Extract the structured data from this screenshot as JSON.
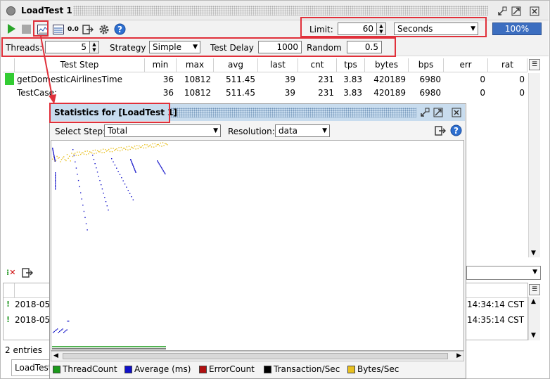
{
  "window": {
    "title": "LoadTest 1"
  },
  "toolbar": {
    "limit_label": "Limit:",
    "limit_value": "60",
    "limit_unit": "Seconds",
    "progress": "100%",
    "rate_display": "0.0"
  },
  "settings": {
    "threads_label": "Threads:",
    "threads_value": "5",
    "strategy_label": "Strategy",
    "strategy_value": "Simple",
    "delay_label": "Test Delay",
    "delay_value": "1000",
    "random_label": "Random",
    "random_value": "0.5"
  },
  "table": {
    "headers": [
      "Test Step",
      "min",
      "max",
      "avg",
      "last",
      "cnt",
      "tps",
      "bytes",
      "bps",
      "err",
      "rat"
    ],
    "rows": [
      {
        "name": "getDomesticAirlinesTime",
        "status_color": "#33cc33",
        "cells": [
          "36",
          "10812",
          "511.45",
          "39",
          "231",
          "3.83",
          "420189",
          "6980",
          "0",
          "0"
        ]
      },
      {
        "name": "TestCase:",
        "status_color": "",
        "cells": [
          "36",
          "10812",
          "511.45",
          "39",
          "231",
          "3.83",
          "420189",
          "6980",
          "0",
          "0"
        ]
      }
    ]
  },
  "log": {
    "entries": [
      {
        "date": "2018-05",
        "time": "14:34:14 CST"
      },
      {
        "date": "2018-05",
        "time": "14:35:14 CST"
      }
    ],
    "count": "2 entries",
    "tab": "LoadTest"
  },
  "stats_window": {
    "title": "Statistics for [LoadTest 1]",
    "select_step_label": "Select Step:",
    "select_step_value": "Total",
    "resolution_label": "Resolution:",
    "resolution_value": "data",
    "legend": [
      {
        "label": "ThreadCount",
        "color": "#1a9a1a"
      },
      {
        "label": "Average (ms)",
        "color": "#1010c8"
      },
      {
        "label": "ErrorCount",
        "color": "#b01010"
      },
      {
        "label": "Transaction/Sec",
        "color": "#000000"
      },
      {
        "label": "Bytes/Sec",
        "color": "#e8c020"
      }
    ]
  }
}
